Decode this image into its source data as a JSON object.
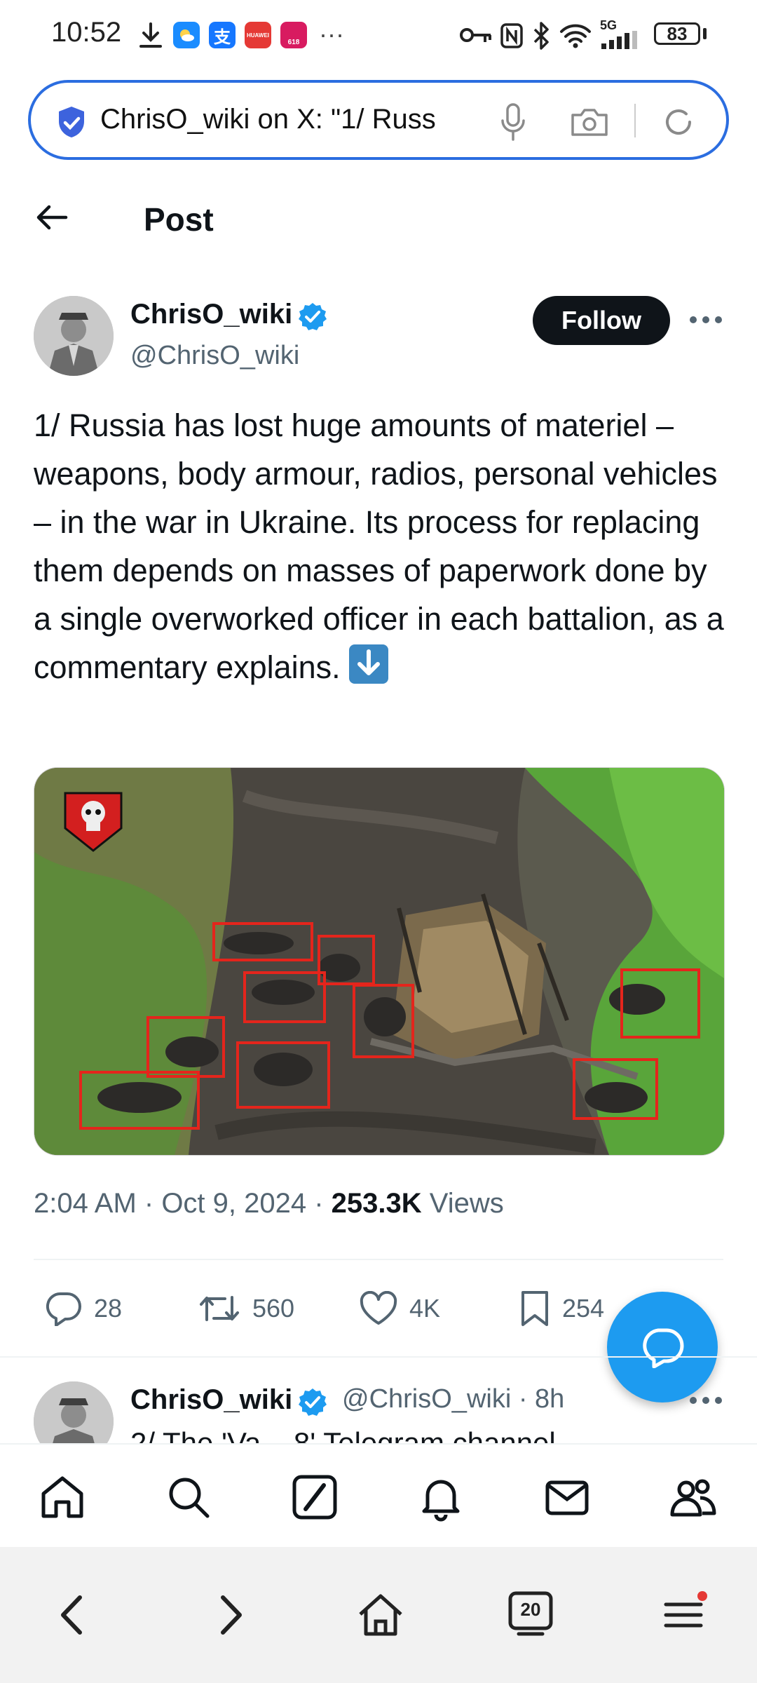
{
  "status_bar": {
    "time": "10:52",
    "notif_apps": [
      "HUAWEI",
      "618"
    ],
    "network": "5G",
    "battery": "83"
  },
  "browser": {
    "url_text": "ChrisO_wiki on X: \"1/ Russ",
    "tab_count": "20"
  },
  "header": {
    "title": "Post"
  },
  "tweet": {
    "author_name": "ChrisO_wiki",
    "author_handle": "@ChrisO_wiki",
    "follow_label": "Follow",
    "text": "1/ Russia has lost huge amounts of materiel – weapons, body armour, radios, personal vehicles – in the war in Ukraine. Its process for replacing them depends on masses of paperwork done by a single overworked officer in each battalion, as a commentary explains.",
    "time": "2:04 AM",
    "date": "Oct 9, 2024",
    "views_count": "253.3K",
    "views_label": "Views",
    "replies": "28",
    "reposts": "560",
    "likes": "4K",
    "bookmarks": "254"
  },
  "reply_tweet": {
    "author_name": "ChrisO_wiki",
    "author_handle": "@ChrisO_wiki · 8h",
    "text": "2/ The 'Va... 8' Telegram channel"
  },
  "colors": {
    "accent": "#1d9bf0",
    "address_border": "#2b6de0",
    "verified": "#1d9bf0",
    "text_secondary": "#536471"
  }
}
